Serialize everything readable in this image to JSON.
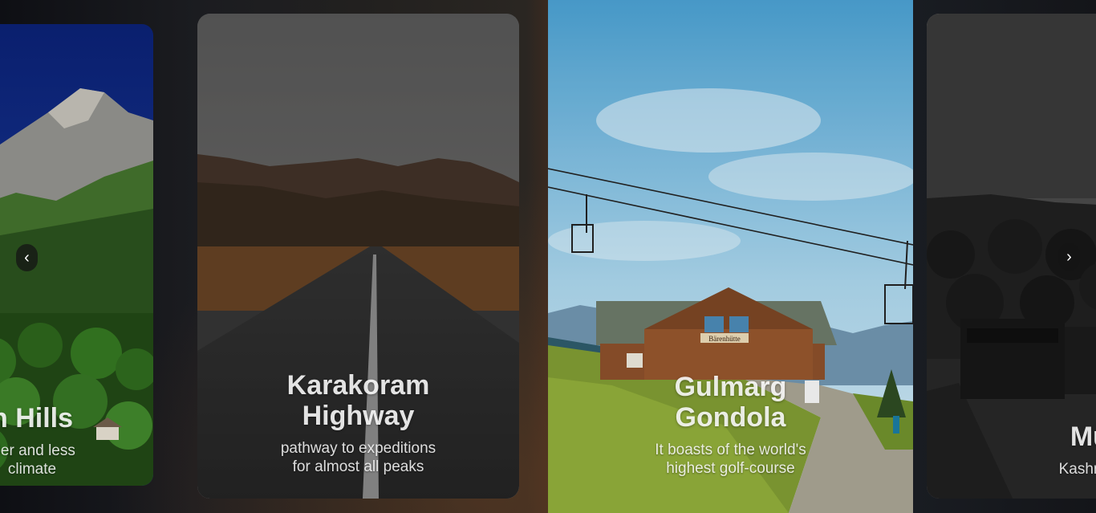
{
  "slides": [
    {
      "title": "n Hills",
      "line1": "oler and less",
      "line2": "climate"
    },
    {
      "title_line1": "Karakoram",
      "title_line2": "Highway",
      "line1": "pathway to expeditions",
      "line2": "for almost all peaks"
    },
    {
      "title_line1": "Gulmarg",
      "title_line2": "Gondola",
      "line1": "It boasts of the world's",
      "line2": "highest golf-course",
      "sign": "Bärenhütte"
    },
    {
      "title": "Mur",
      "line1": "Kashmir of"
    }
  ],
  "nav": {
    "prev_icon": "‹",
    "next_icon": "›"
  }
}
